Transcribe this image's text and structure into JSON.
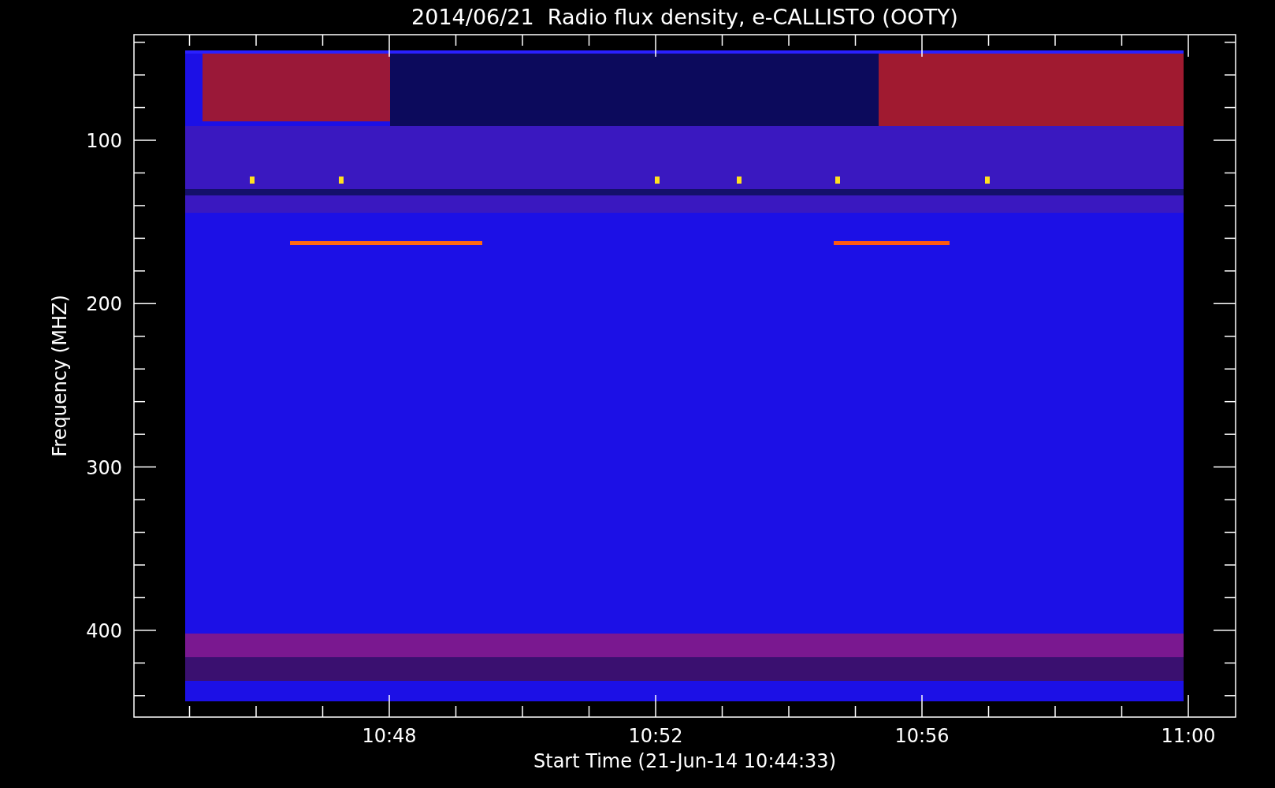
{
  "title": "2014/06/21  Radio flux density, e-CALLISTO (OOTY)",
  "y_axis": {
    "label": "Frequency (MHZ)",
    "ticks": [
      "100",
      "200",
      "300",
      "400"
    ]
  },
  "x_axis": {
    "label": "Start Time (21-Jun-14 10:44:33)",
    "ticks": [
      "10:48",
      "10:52",
      "10:56",
      "11:00"
    ]
  }
}
